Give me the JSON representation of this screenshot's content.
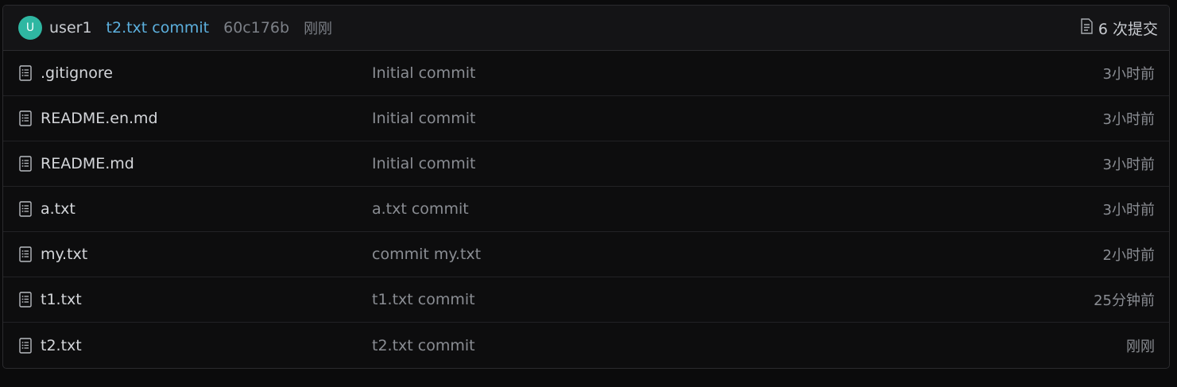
{
  "latest_commit": {
    "avatar_initial": "U",
    "author": "user1",
    "message": "t2.txt commit",
    "sha": "60c176b",
    "time": "刚刚",
    "commit_count_label": "6 次提交",
    "commit_count_icon": "commits-icon"
  },
  "files": [
    {
      "name": ".gitignore",
      "message": "Initial commit",
      "time": "3小时前",
      "icon": "file-icon"
    },
    {
      "name": "README.en.md",
      "message": "Initial commit",
      "time": "3小时前",
      "icon": "file-icon"
    },
    {
      "name": "README.md",
      "message": "Initial commit",
      "time": "3小时前",
      "icon": "file-icon"
    },
    {
      "name": "a.txt",
      "message": "a.txt commit",
      "time": "3小时前",
      "icon": "file-icon"
    },
    {
      "name": "my.txt",
      "message": "commit my.txt",
      "time": "2小时前",
      "icon": "file-icon"
    },
    {
      "name": "t1.txt",
      "message": "t1.txt commit",
      "time": "25分钟前",
      "icon": "file-icon"
    },
    {
      "name": "t2.txt",
      "message": "t2.txt commit",
      "time": "刚刚",
      "icon": "file-icon"
    }
  ],
  "colors": {
    "avatar_bg": "#2fb7a2",
    "link": "#5cb0de",
    "background": "#0d0d0e"
  }
}
